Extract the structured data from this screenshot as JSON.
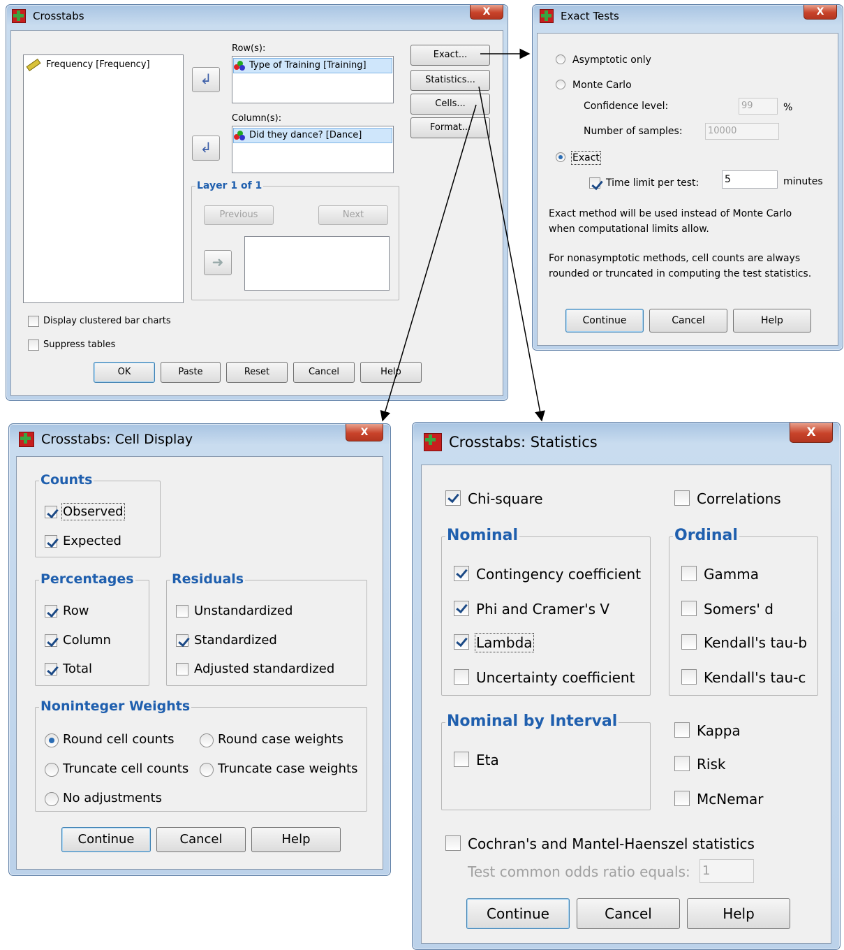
{
  "crosstabs": {
    "title": "Crosstabs",
    "close_glyph": "X",
    "variable_list": [
      "Frequency [Frequency]"
    ],
    "rows_label": "Row(s):",
    "rows_items": [
      "Type of Training [Training]"
    ],
    "columns_label": "Column(s):",
    "columns_items": [
      "Did they dance? [Dance]"
    ],
    "layer_label": "Layer 1 of 1",
    "previous": "Previous",
    "next": "Next",
    "side_buttons": {
      "exact": "Exact...",
      "statistics": "Statistics...",
      "cells": "Cells...",
      "format": "Format..."
    },
    "clustered_bar": "Display clustered bar charts",
    "suppress": "Suppress tables",
    "buttons": {
      "ok": "OK",
      "paste": "Paste",
      "reset": "Reset",
      "cancel": "Cancel",
      "help": "Help"
    }
  },
  "exact_tests": {
    "title": "Exact Tests",
    "close_glyph": "X",
    "asymptotic": "Asymptotic only",
    "monte_carlo": "Monte Carlo",
    "confidence_label": "Confidence level:",
    "confidence_value": "99",
    "percent": "%",
    "samples_label": "Number of samples:",
    "samples_value": "10000",
    "exact": "Exact",
    "time_limit_label": "Time limit per test:",
    "time_limit_value": "5",
    "minutes": "minutes",
    "note1_line1": "Exact method will be used instead of Monte Carlo",
    "note1_line2": "when computational limits allow.",
    "note2_line1": "For nonasymptotic methods, cell counts are always",
    "note2_line2": "rounded or truncated in computing the test statistics.",
    "selected_method": "Exact",
    "time_limit_checked": true,
    "buttons": {
      "continue": "Continue",
      "cancel": "Cancel",
      "help": "Help"
    }
  },
  "cell_display": {
    "title": "Crosstabs: Cell Display",
    "close_glyph": "X",
    "counts_title": "Counts",
    "observed": "Observed",
    "expected": "Expected",
    "percentages_title": "Percentages",
    "row": "Row",
    "column": "Column",
    "total": "Total",
    "residuals_title": "Residuals",
    "unstandardized": "Unstandardized",
    "standardized": "Standardized",
    "adjusted": "Adjusted standardized",
    "weights_title": "Noninteger Weights",
    "round_cell": "Round cell counts",
    "round_case": "Round case weights",
    "truncate_cell": "Truncate cell counts",
    "truncate_case": "Truncate case weights",
    "no_adjust": "No adjustments",
    "checked": {
      "observed": true,
      "expected": true,
      "row": true,
      "column": true,
      "total": true,
      "unstandardized": false,
      "standardized": true,
      "adjusted": false
    },
    "selected_weight": "Round cell counts",
    "buttons": {
      "continue": "Continue",
      "cancel": "Cancel",
      "help": "Help"
    }
  },
  "statistics": {
    "title": "Crosstabs: Statistics",
    "close_glyph": "X",
    "chi_square": "Chi-square",
    "correlations": "Correlations",
    "nominal_title": "Nominal",
    "contingency": "Contingency coefficient",
    "phi": "Phi and Cramer's V",
    "lambda": "Lambda",
    "uncertainty": "Uncertainty coefficient",
    "ordinal_title": "Ordinal",
    "gamma": "Gamma",
    "somers": "Somers' d",
    "tau_b": "Kendall's tau-b",
    "tau_c": "Kendall's tau-c",
    "nbi_title": "Nominal by Interval",
    "eta": "Eta",
    "kappa": "Kappa",
    "risk": "Risk",
    "mcnemar": "McNemar",
    "cmh": "Cochran's and Mantel-Haenszel statistics",
    "odds_label": "Test common odds ratio equals:",
    "odds_value": "1",
    "checked": {
      "chi_square": true,
      "correlations": false,
      "contingency": true,
      "phi": true,
      "lambda": true,
      "uncertainty": false,
      "gamma": false,
      "somers": false,
      "tau_b": false,
      "tau_c": false,
      "eta": false,
      "kappa": false,
      "risk": false,
      "mcnemar": false,
      "cmh": false
    },
    "buttons": {
      "continue": "Continue",
      "cancel": "Cancel",
      "help": "Help"
    }
  },
  "colors": {
    "legend_blue": "#1f5fae",
    "title_frame": "#bcd2ea",
    "close_red": "#c8432a"
  },
  "icons": [
    "crosstabs-app-icon",
    "ruler-icon",
    "nominal-variable-icon",
    "move-arrow-icon",
    "close-icon"
  ]
}
